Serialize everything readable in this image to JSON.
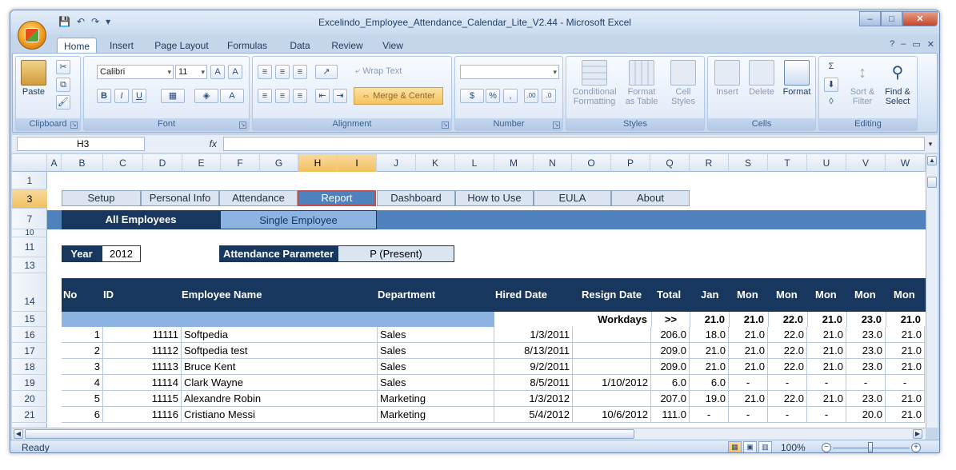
{
  "window": {
    "title": "Excelindo_Employee_Attendance_Calendar_Lite_V2.44 - Microsoft Excel",
    "minimize": "–",
    "maximize": "□",
    "close": "✕"
  },
  "ribbon_tabs": [
    "Home",
    "Insert",
    "Page Layout",
    "Formulas",
    "Data",
    "Review",
    "View"
  ],
  "ribbon": {
    "clipboard": {
      "label": "Clipboard",
      "paste": "Paste"
    },
    "font": {
      "label": "Font",
      "name": "Calibri",
      "size": "11",
      "bold": "B",
      "italic": "I",
      "underline": "U"
    },
    "alignment": {
      "label": "Alignment",
      "wrap": "Wrap Text",
      "merge": "Merge & Center"
    },
    "number": {
      "label": "Number",
      "currency": "$",
      "percent": "%",
      "comma": ","
    },
    "styles": {
      "label": "Styles",
      "conditional": "Conditional Formatting",
      "format_table": "Format as Table",
      "cell_styles": "Cell Styles"
    },
    "cells": {
      "label": "Cells",
      "insert": "Insert",
      "delete": "Delete",
      "format": "Format"
    },
    "editing": {
      "label": "Editing",
      "sort": "Sort & Filter",
      "find": "Find & Select"
    }
  },
  "formula_bar": {
    "name_box": "H3",
    "fx": "fx",
    "formula": ""
  },
  "columns": [
    "A",
    "B",
    "C",
    "D",
    "E",
    "F",
    "G",
    "H",
    "I",
    "J",
    "K",
    "L",
    "M",
    "N",
    "O",
    "P",
    "Q",
    "R",
    "S",
    "T",
    "U",
    "V",
    "W"
  ],
  "rows": [
    "1",
    "3",
    "7",
    "10",
    "11",
    "13",
    "14",
    "15",
    "16",
    "17",
    "18",
    "19",
    "20",
    "21"
  ],
  "nav_buttons": [
    "Setup",
    "Personal Info",
    "Attendance",
    "Report",
    "Dashboard",
    "How to Use",
    "EULA",
    "About"
  ],
  "sub_tabs": [
    "All Employees",
    "Single Employee"
  ],
  "year": {
    "label": "Year",
    "value": "2012"
  },
  "parameter": {
    "label": "Attendance Parameter",
    "value": "P (Present)"
  },
  "table_headers": [
    "No",
    "ID",
    "Employee Name",
    "Department",
    "Hired Date",
    "Resign Date",
    "Total",
    "Jan",
    "Mon",
    "Mon",
    "Mon",
    "Mon",
    "Mon"
  ],
  "workdays": {
    "label": "Workdays",
    "arrow": ">>",
    "values": [
      "21.0",
      "21.0",
      "22.0",
      "21.0",
      "23.0",
      "21.0"
    ]
  },
  "employees": [
    {
      "no": "1",
      "id": "11111",
      "name": "Softpedia",
      "dept": "Sales",
      "hired": "1/3/2011",
      "resign": "",
      "total": "206.0",
      "m": [
        "18.0",
        "21.0",
        "22.0",
        "21.0",
        "23.0",
        "21.0"
      ]
    },
    {
      "no": "2",
      "id": "11112",
      "name": "Softpedia test",
      "dept": "Sales",
      "hired": "8/13/2011",
      "resign": "",
      "total": "209.0",
      "m": [
        "21.0",
        "21.0",
        "22.0",
        "21.0",
        "23.0",
        "21.0"
      ]
    },
    {
      "no": "3",
      "id": "11113",
      "name": "Bruce Kent",
      "dept": "Sales",
      "hired": "9/2/2011",
      "resign": "",
      "total": "209.0",
      "m": [
        "21.0",
        "21.0",
        "22.0",
        "21.0",
        "23.0",
        "21.0"
      ]
    },
    {
      "no": "4",
      "id": "11114",
      "name": "Clark Wayne",
      "dept": "Sales",
      "hired": "8/5/2011",
      "resign": "1/10/2012",
      "total": "6.0",
      "m": [
        "6.0",
        "-",
        "-",
        "-",
        "-",
        "-"
      ]
    },
    {
      "no": "5",
      "id": "11115",
      "name": "Alexandre Robin",
      "dept": "Marketing",
      "hired": "1/3/2012",
      "resign": "",
      "total": "207.0",
      "m": [
        "19.0",
        "21.0",
        "22.0",
        "21.0",
        "23.0",
        "21.0"
      ]
    },
    {
      "no": "6",
      "id": "11116",
      "name": "Cristiano Messi",
      "dept": "Marketing",
      "hired": "5/4/2012",
      "resign": "10/6/2012",
      "total": "111.0",
      "m": [
        "-",
        "-",
        "-",
        "-",
        "20.0",
        "21.0"
      ]
    }
  ],
  "status": {
    "ready": "Ready",
    "zoom": "100%"
  }
}
